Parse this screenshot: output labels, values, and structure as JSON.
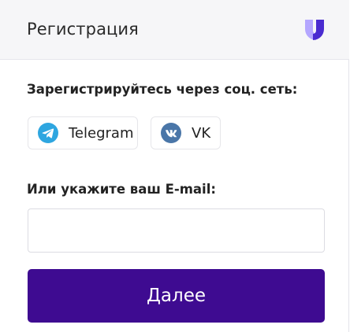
{
  "header": {
    "title": "Регистрация",
    "logo_icon": "brand-logo-icon"
  },
  "social": {
    "label": "Зарегистрируйтесь через соц. сеть:",
    "buttons": [
      {
        "label": "Telegram",
        "icon": "telegram-icon",
        "color": "#2ea6e0"
      },
      {
        "label": "VK",
        "icon": "vk-icon",
        "color": "#4a76a8"
      }
    ]
  },
  "email": {
    "label": "Или укажите ваш E-mail:",
    "value": "",
    "placeholder": ""
  },
  "next_button": {
    "label": "Далее",
    "color": "#3e0b91"
  },
  "colors": {
    "accent": "#3e0b91",
    "logo_light": "#b4a6ff",
    "logo_dark": "#4a2bd0"
  }
}
